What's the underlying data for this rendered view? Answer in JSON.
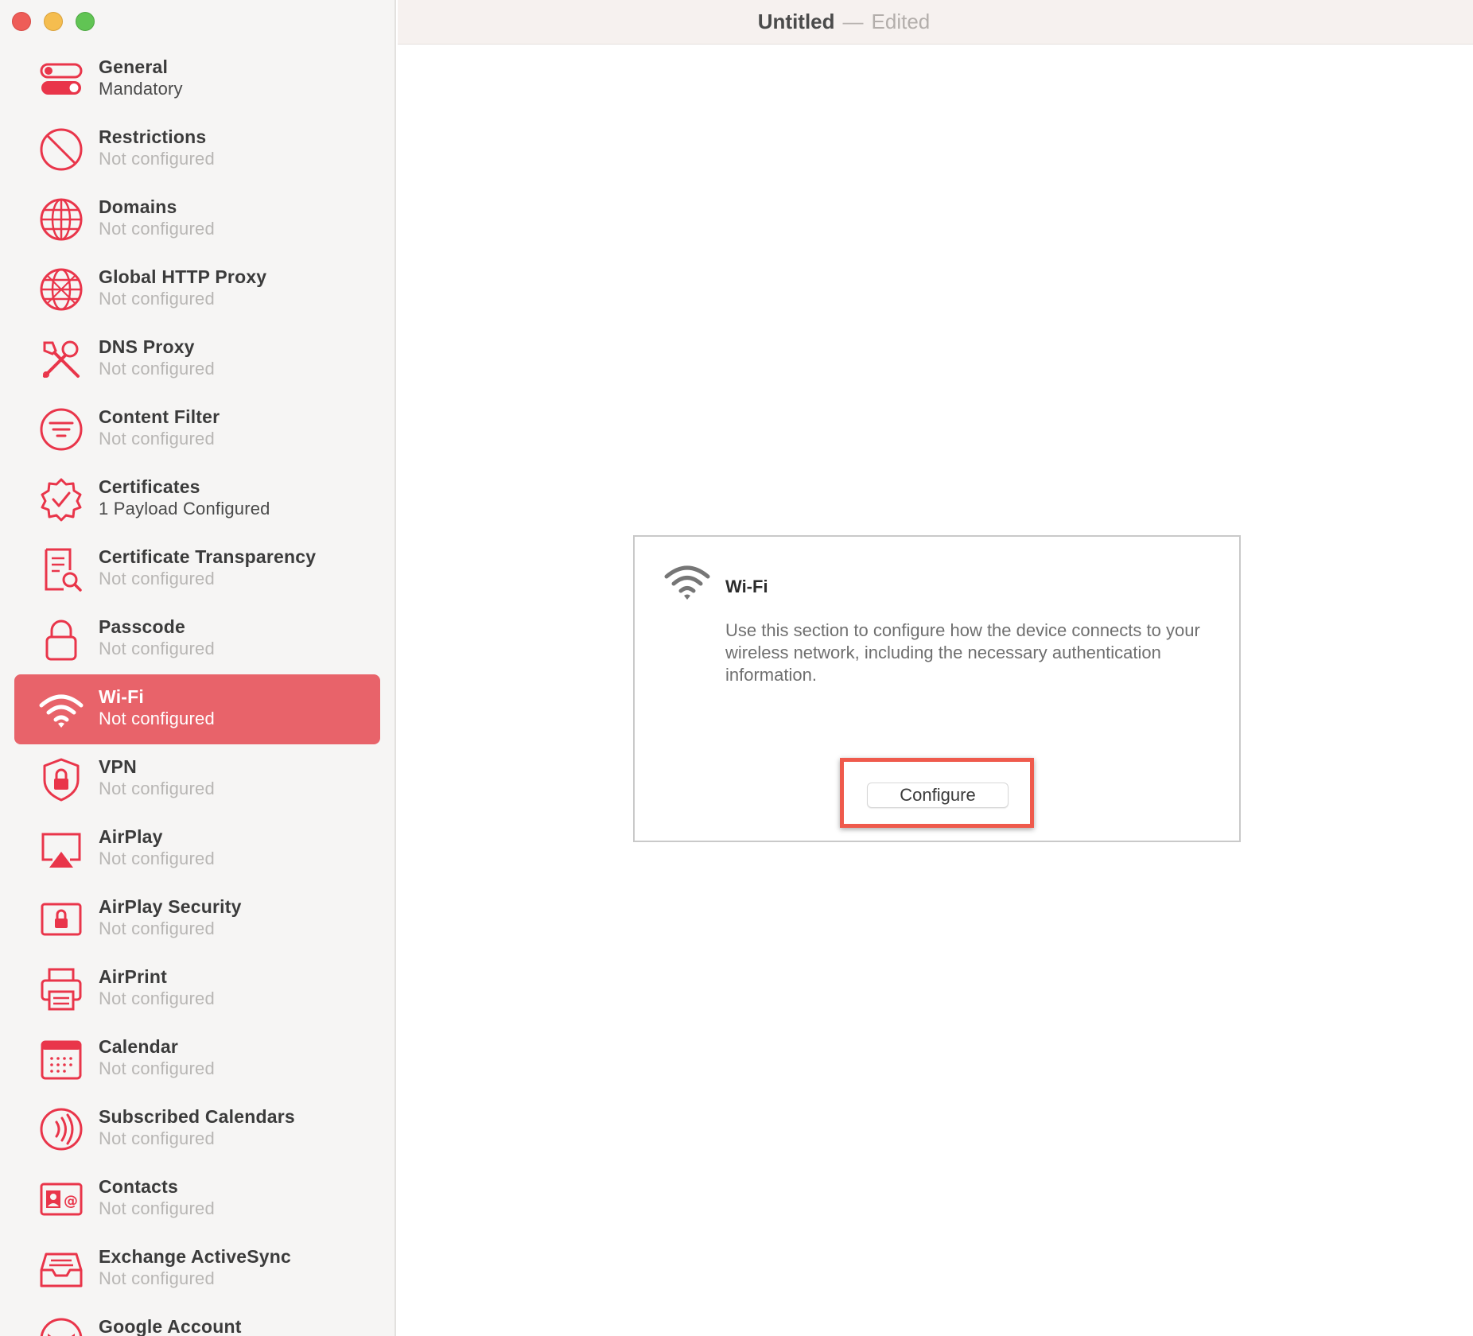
{
  "window": {
    "title": "Untitled",
    "title_separator": "—",
    "status": "Edited"
  },
  "colors": {
    "accent": "#e8636a",
    "icon_red": "#e9354a",
    "highlight": "#ef5a4c"
  },
  "sidebar": {
    "items": [
      {
        "id": "general",
        "title": "General",
        "status": "Mandatory",
        "icon": "toggle-icon",
        "status_dark": true
      },
      {
        "id": "restrictions",
        "title": "Restrictions",
        "status": "Not configured",
        "icon": "prohibited-icon"
      },
      {
        "id": "domains",
        "title": "Domains",
        "status": "Not configured",
        "icon": "globe-icon"
      },
      {
        "id": "global-http-proxy",
        "title": "Global HTTP Proxy",
        "status": "Not configured",
        "icon": "globe-network-icon"
      },
      {
        "id": "dns-proxy",
        "title": "DNS Proxy",
        "status": "Not configured",
        "icon": "tools-icon"
      },
      {
        "id": "content-filter",
        "title": "Content Filter",
        "status": "Not configured",
        "icon": "filter-icon"
      },
      {
        "id": "certificates",
        "title": "Certificates",
        "status": "1 Payload Configured",
        "icon": "certificate-badge-icon",
        "status_dark": true
      },
      {
        "id": "certificate-transparency",
        "title": "Certificate Transparency",
        "status": "Not configured",
        "icon": "document-search-icon"
      },
      {
        "id": "passcode",
        "title": "Passcode",
        "status": "Not configured",
        "icon": "lock-icon"
      },
      {
        "id": "wifi",
        "title": "Wi-Fi",
        "status": "Not configured",
        "icon": "wifi-icon",
        "selected": true
      },
      {
        "id": "vpn",
        "title": "VPN",
        "status": "Not configured",
        "icon": "shield-lock-icon"
      },
      {
        "id": "airplay",
        "title": "AirPlay",
        "status": "Not configured",
        "icon": "airplay-icon"
      },
      {
        "id": "airplay-security",
        "title": "AirPlay Security",
        "status": "Not configured",
        "icon": "screen-lock-icon"
      },
      {
        "id": "airprint",
        "title": "AirPrint",
        "status": "Not configured",
        "icon": "printer-icon"
      },
      {
        "id": "calendar",
        "title": "Calendar",
        "status": "Not configured",
        "icon": "calendar-icon"
      },
      {
        "id": "subscribed-calendars",
        "title": "Subscribed Calendars",
        "status": "Not configured",
        "icon": "broadcast-icon"
      },
      {
        "id": "contacts",
        "title": "Contacts",
        "status": "Not configured",
        "icon": "contact-card-icon"
      },
      {
        "id": "exchange-activesync",
        "title": "Exchange ActiveSync",
        "status": "Not configured",
        "icon": "inbox-tray-icon"
      },
      {
        "id": "google-account",
        "title": "Google Account",
        "status": "",
        "icon": "mail-icon"
      }
    ]
  },
  "panel": {
    "title": "Wi-Fi",
    "description": "Use this section to configure how the device connects to your wireless network, including the necessary authentication information.",
    "icon": "wifi-icon",
    "configure_label": "Configure"
  }
}
